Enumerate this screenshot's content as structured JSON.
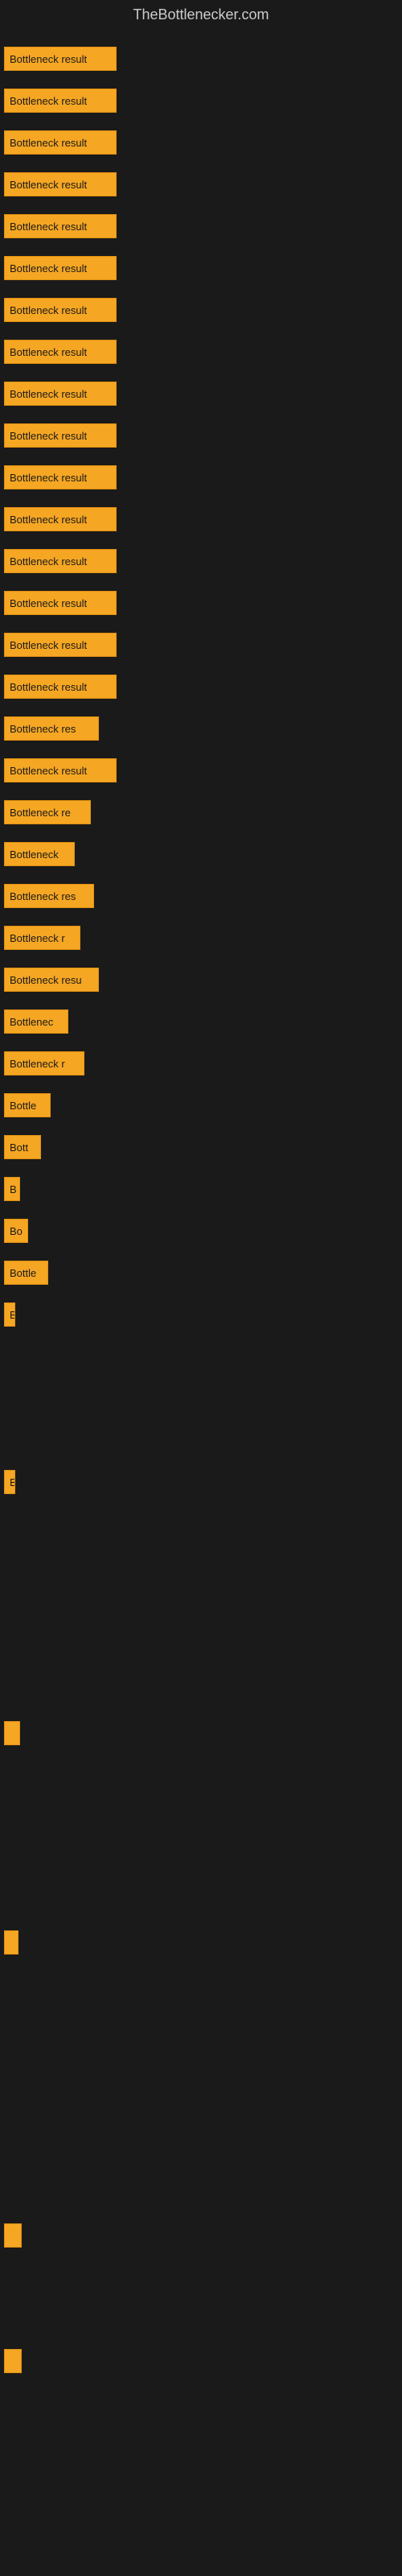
{
  "site": {
    "title": "TheBottlenecker.com"
  },
  "bars": [
    {
      "label": "Bottleneck result",
      "width": 140
    },
    {
      "label": "Bottleneck result",
      "width": 140
    },
    {
      "label": "Bottleneck result",
      "width": 140
    },
    {
      "label": "Bottleneck result",
      "width": 140
    },
    {
      "label": "Bottleneck result",
      "width": 140
    },
    {
      "label": "Bottleneck result",
      "width": 140
    },
    {
      "label": "Bottleneck result",
      "width": 140
    },
    {
      "label": "Bottleneck result",
      "width": 140
    },
    {
      "label": "Bottleneck result",
      "width": 140
    },
    {
      "label": "Bottleneck result",
      "width": 140
    },
    {
      "label": "Bottleneck result",
      "width": 140
    },
    {
      "label": "Bottleneck result",
      "width": 140
    },
    {
      "label": "Bottleneck result",
      "width": 140
    },
    {
      "label": "Bottleneck result",
      "width": 140
    },
    {
      "label": "Bottleneck result",
      "width": 140
    },
    {
      "label": "Bottleneck result",
      "width": 140
    },
    {
      "label": "Bottleneck res",
      "width": 118
    },
    {
      "label": "Bottleneck result",
      "width": 140
    },
    {
      "label": "Bottleneck re",
      "width": 108
    },
    {
      "label": "Bottleneck",
      "width": 88
    },
    {
      "label": "Bottleneck res",
      "width": 112
    },
    {
      "label": "Bottleneck r",
      "width": 95
    },
    {
      "label": "Bottleneck resu",
      "width": 118
    },
    {
      "label": "Bottlenec",
      "width": 80
    },
    {
      "label": "Bottleneck r",
      "width": 100
    },
    {
      "label": "Bottle",
      "width": 58
    },
    {
      "label": "Bott",
      "width": 46
    },
    {
      "label": "B",
      "width": 20
    },
    {
      "label": "Bo",
      "width": 30
    },
    {
      "label": "Bottle",
      "width": 55
    },
    {
      "label": "B",
      "width": 14
    },
    {
      "label": "",
      "width": 0
    },
    {
      "label": "",
      "width": 0
    },
    {
      "label": "",
      "width": 0
    },
    {
      "label": "B",
      "width": 14
    },
    {
      "label": "",
      "width": 0
    },
    {
      "label": "",
      "width": 0
    },
    {
      "label": "",
      "width": 0
    },
    {
      "label": "",
      "width": 0
    },
    {
      "label": "",
      "width": 0
    },
    {
      "label": "",
      "width": 20
    },
    {
      "label": "",
      "width": 0
    },
    {
      "label": "",
      "width": 0
    },
    {
      "label": "",
      "width": 0
    },
    {
      "label": "",
      "width": 0
    },
    {
      "label": "",
      "width": 18
    },
    {
      "label": "",
      "width": 0
    },
    {
      "label": "",
      "width": 0
    },
    {
      "label": "",
      "width": 0
    },
    {
      "label": "",
      "width": 0
    },
    {
      "label": "",
      "width": 0
    },
    {
      "label": "",
      "width": 0
    },
    {
      "label": "",
      "width": 22
    },
    {
      "label": "",
      "width": 0
    },
    {
      "label": "",
      "width": 0
    },
    {
      "label": "",
      "width": 22
    },
    {
      "label": "",
      "width": 0
    }
  ]
}
